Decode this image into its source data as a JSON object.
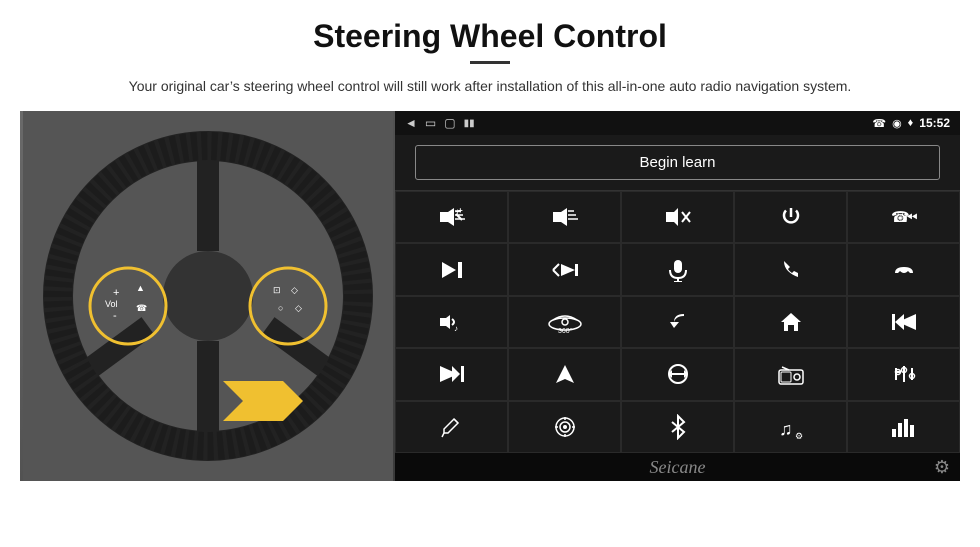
{
  "page": {
    "title": "Steering Wheel Control",
    "subtitle": "Your original car’s steering wheel control will still work after installation of this all-in-one auto radio navigation system.",
    "divider": ""
  },
  "status_bar": {
    "time": "15:52",
    "back_icon": "◄",
    "home_icon": "⎕",
    "recent_icon": "□",
    "signal_icon": "♢",
    "wifi_icon": "♢",
    "phone_icon": "☎",
    "location_icon": "⌖"
  },
  "begin_learn": {
    "label": "Begin learn"
  },
  "controls": [
    {
      "icon": "🔊+",
      "name": "vol-up"
    },
    {
      "icon": "🔊-",
      "name": "vol-down"
    },
    {
      "icon": "🔇",
      "name": "mute"
    },
    {
      "icon": "⏻",
      "name": "power"
    },
    {
      "icon": "⏮",
      "name": "prev-track"
    },
    {
      "icon": "⏭",
      "name": "next-track"
    },
    {
      "icon": "⏭✂",
      "name": "scan"
    },
    {
      "icon": "🎙",
      "name": "mic"
    },
    {
      "icon": "📞",
      "name": "call"
    },
    {
      "icon": "📵",
      "name": "end-call"
    },
    {
      "icon": "📢",
      "name": "horn"
    },
    {
      "icon": "360°",
      "name": "360-view"
    },
    {
      "icon": "↩",
      "name": "back"
    },
    {
      "icon": "🏠",
      "name": "home"
    },
    {
      "icon": "⏮⏮",
      "name": "fast-prev"
    },
    {
      "icon": "⏭⏭",
      "name": "fast-next"
    },
    {
      "icon": "➤",
      "name": "nav"
    },
    {
      "icon": "⇌",
      "name": "swap"
    },
    {
      "icon": "📻",
      "name": "radio"
    },
    {
      "icon": "🎛",
      "name": "equalizer"
    },
    {
      "icon": "✏",
      "name": "edit"
    },
    {
      "icon": "🎯",
      "name": "target"
    },
    {
      "icon": "🔵",
      "name": "bluetooth"
    },
    {
      "icon": "🎵",
      "name": "music"
    },
    {
      "icon": "📊",
      "name": "levels"
    }
  ],
  "bottom_bar": {
    "brand": "Seicane",
    "gear": "⚙"
  }
}
